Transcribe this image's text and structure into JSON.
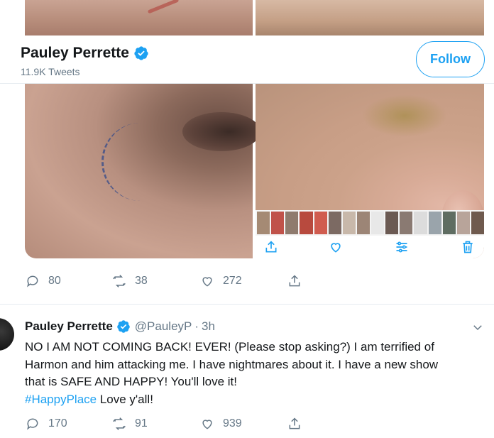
{
  "colors": {
    "accent": "#1da1f2",
    "text_secondary": "#657786",
    "text_primary": "#14171a",
    "divider": "#e6ecf0"
  },
  "header": {
    "profile_name": "Pauley Perrette",
    "tweet_count": "11.9K Tweets",
    "follow_label": "Follow"
  },
  "media": {
    "tools": [
      "share-icon",
      "heart-icon",
      "adjust-icon",
      "trash-icon"
    ]
  },
  "tweet1": {
    "replies": "80",
    "retweets": "38",
    "likes": "272"
  },
  "tweet2": {
    "name": "Pauley Perrette",
    "handle": "@PauleyP",
    "separator": "·",
    "time": "3h",
    "text_lines": [
      "NO I AM NOT COMING BACK! EVER!  (Please stop asking?) I am terrified of",
      "Harmon and him attacking me. I have nightmares about it. I have a new show",
      "that is SAFE AND HAPPY! You'll love it!"
    ],
    "hashtag": "#HappyPlace",
    "tail": " Love y'all!",
    "replies": "170",
    "retweets": "91",
    "likes": "939"
  }
}
